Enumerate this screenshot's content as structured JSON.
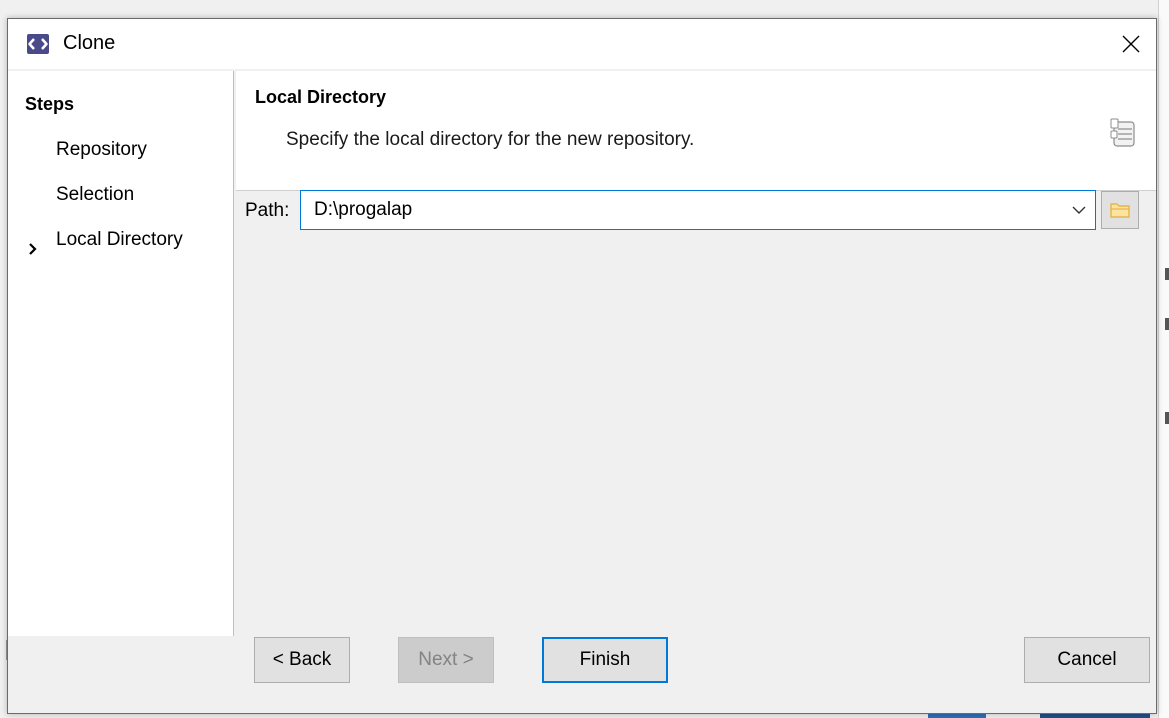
{
  "dialog": {
    "title": "Clone",
    "icon": "egit-clone-icon",
    "close_symbol": "close-icon"
  },
  "steps": {
    "heading": "Steps",
    "items": [
      {
        "label": "Repository",
        "current": false
      },
      {
        "label": "Selection",
        "current": false
      },
      {
        "label": "Local Directory",
        "current": true
      }
    ]
  },
  "page": {
    "title": "Local Directory",
    "description": "Specify the local directory for the new repository.",
    "icon": "wizard-banner-icon"
  },
  "path": {
    "label": "Path:",
    "value": "D:\\progalap"
  },
  "buttons": {
    "back": "< Back",
    "next": "Next >",
    "finish": "Finish",
    "cancel": "Cancel"
  },
  "colors": {
    "focus_border": "#0078d7",
    "folder_icon": "#e8b54a",
    "app_icon_bg": "#4a4a8a",
    "disabled_text": "#838383"
  }
}
